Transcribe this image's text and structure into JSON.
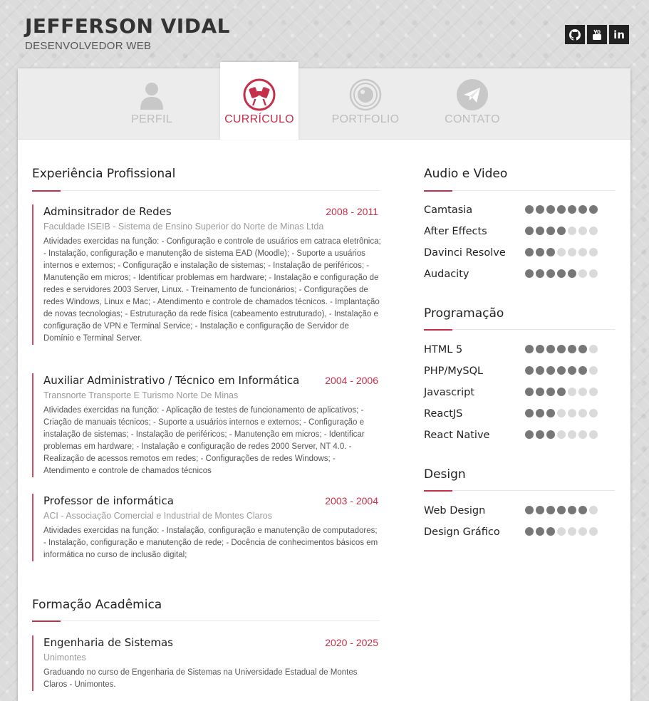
{
  "header": {
    "name": "JEFFERSON VIDAL",
    "role": "DESENVOLVEDOR WEB"
  },
  "social": [
    {
      "icon": "github-icon",
      "label": "GitHub"
    },
    {
      "icon": "youtube-icon",
      "label": "YouTube"
    },
    {
      "icon": "linkedin-icon",
      "label": "in"
    }
  ],
  "tabs": [
    {
      "label": "PERFIL",
      "icon": "user-icon",
      "active": false
    },
    {
      "label": "CURRÍCULO",
      "icon": "telescope-icon",
      "active": true
    },
    {
      "label": "PORTFOLIO",
      "icon": "camera-lens-icon",
      "active": false
    },
    {
      "label": "CONTATO",
      "icon": "paper-plane-icon",
      "active": false
    }
  ],
  "colors": {
    "accent": "#c4304a",
    "dot_on": "#777777",
    "dot_off": "#dadada"
  },
  "experience": {
    "title": "Experiência Profissional",
    "items": [
      {
        "title": "Adminsitrador de Redes",
        "date": "2008 - 2011",
        "org": "Faculdade ISEIB - Sistema de Ensino Superior do Norte de Minas Ltda",
        "desc": "Atividades exercidas na função: - Configuração e controle de usuários em catraca eletrônica; - Instalação, configuração e manutenção de sistema EAD (Moodle); - Suporte a usuários internos e externos; - Configuração e instalação de sistemas; - Instalação de periféricos; - Manutenção em micros; - Identificar problemas em hardware; - Instalação e configuração de redes e servidores 2003 Server, Linux. - Treinamento de funcionários; - Configurações de redes Windows, Linux e Mac; - Atendimento e controle de chamados técnicos. - Implantação de novas tecnologias; - Estruturação da rede física (cabeamento estruturado), - Instalação e configuração de VPN e Terminal Service; - Instalação e configuração de Servidor de Domínio e Terminal Server."
      },
      {
        "title": "Auxiliar Administrativo / Técnico em Informática",
        "date": "2004 - 2006",
        "org": "Transnorte Transporte E Turismo Norte De Minas",
        "desc": "Atividades exercidas na função: - Aplicação de testes de funcionamento de aplicativos; - Criação de manuais técnicos; - Suporte a usuários internos e externos; - Configuração e instalação de sistemas; - Instalação de periféricos; - Manutenção em micros; - Identificar problemas em hardware; - Instalação e configuração de redes 2000 Server, NT 4.0. - Realização de acessos remotos em redes; - Configurações de redes Windows; - Atendimento e controle de chamados técnicos"
      },
      {
        "title": "Professor de informática",
        "date": "2003 - 2004",
        "org": "ACI - Associação Comercial e Industrial de Montes Claros",
        "desc": "Atividades exercidas na função: - Instalação, configuração e manutenção de computadores; - Instalação, configuração e manutenção de rede; - Docência de conhecimentos básicos em informática no curso de inclusão digital;"
      }
    ]
  },
  "education": {
    "title": "Formação Acadêmica",
    "items": [
      {
        "title": "Engenharia de Sistemas",
        "date": "2020 - 2025",
        "org": "Unimontes",
        "desc": "Graduando no curso de Engenharia de Sistemas na Universidade Estadual de Montes Claros - Unimontes."
      }
    ]
  },
  "skills": [
    {
      "title": "Audio e Video",
      "items": [
        {
          "name": "Camtasia",
          "level": 7
        },
        {
          "name": "After Effects",
          "level": 4
        },
        {
          "name": "Davinci Resolve",
          "level": 3
        },
        {
          "name": "Audacity",
          "level": 5
        }
      ]
    },
    {
      "title": "Programação",
      "items": [
        {
          "name": "HTML 5",
          "level": 6
        },
        {
          "name": "PHP/MySQL",
          "level": 6
        },
        {
          "name": "Javascript",
          "level": 4
        },
        {
          "name": "ReactJS",
          "level": 3
        },
        {
          "name": "React Native",
          "level": 3
        }
      ]
    },
    {
      "title": "Design",
      "items": [
        {
          "name": "Web Design",
          "level": 6
        },
        {
          "name": "Design Gráfico",
          "level": 3
        }
      ]
    }
  ],
  "skill_scale_max": 7
}
